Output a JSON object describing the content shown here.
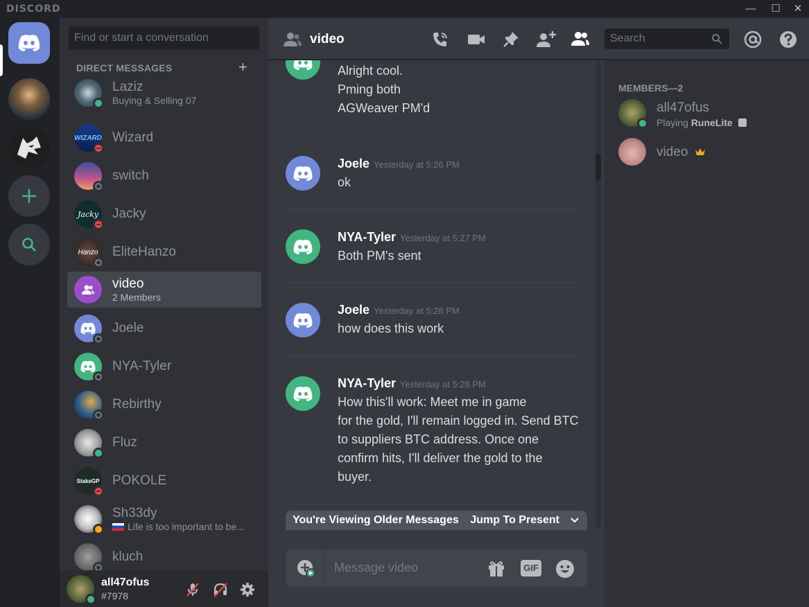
{
  "app": {
    "brand": "DISCORD"
  },
  "dm_panel": {
    "search_placeholder": "Find or start a conversation",
    "section_title": "DIRECT MESSAGES",
    "items": [
      {
        "name": "Laziz",
        "sub": "Buying & Selling 07",
        "status": "online"
      },
      {
        "name": "Wizard",
        "sub": "",
        "status": "dnd"
      },
      {
        "name": "switch",
        "sub": "",
        "status": "offline"
      },
      {
        "name": "Jacky",
        "sub": "",
        "status": "dnd"
      },
      {
        "name": "EliteHanzo",
        "sub": "",
        "status": "offline"
      },
      {
        "name": "video",
        "sub": "2 Members",
        "status": "group",
        "selected": true
      },
      {
        "name": "Joele",
        "sub": "",
        "status": "offline"
      },
      {
        "name": "NYA-Tyler",
        "sub": "",
        "status": "offline"
      },
      {
        "name": "Rebirthy",
        "sub": "",
        "status": "offline"
      },
      {
        "name": "Fluz",
        "sub": "",
        "status": "online"
      },
      {
        "name": "POKOLE",
        "sub": "",
        "status": "dnd"
      },
      {
        "name": "Sh33dy",
        "sub": "Life is too important to be...",
        "status": "idle"
      },
      {
        "name": "kluch",
        "sub": "",
        "status": "offline"
      }
    ]
  },
  "user_panel": {
    "username": "all47ofus",
    "tag": "#7978"
  },
  "header": {
    "channel": "video",
    "search_placeholder": "Search"
  },
  "messages": {
    "partial": {
      "lines": [
        "Alright cool.",
        "Pming both",
        "AGWeaver PM'd"
      ]
    },
    "items": [
      {
        "author": "Joele",
        "time": "Yesterday at 5:26 PM",
        "lines": [
          "ok"
        ],
        "avatar_color": "#7289da"
      },
      {
        "author": "NYA-Tyler",
        "time": "Yesterday at 5:27 PM",
        "lines": [
          "Both PM's sent"
        ],
        "avatar_color": "#43b581"
      },
      {
        "author": "Joele",
        "time": "Yesterday at 5:28 PM",
        "lines": [
          "how does this work"
        ],
        "avatar_color": "#7289da"
      },
      {
        "author": "NYA-Tyler",
        "time": "Yesterday at 5:28 PM",
        "lines": [
          "How this'll work: Meet me in game",
          "for the gold, I'll remain logged in. Send BTC",
          "to suppliers BTC address. Once one",
          "confirm hits, I'll deliver the gold to the",
          "buyer."
        ],
        "avatar_color": "#43b581"
      }
    ]
  },
  "older_bar": {
    "text": "You're Viewing Older Messages",
    "jump": "Jump To Present"
  },
  "composer": {
    "placeholder": "Message video",
    "gif": "GIF"
  },
  "member_list": {
    "header": "MEMBERS—2",
    "members": [
      {
        "name": "all47ofus",
        "activity_prefix": "Playing",
        "activity": "RuneLite",
        "status": "online"
      },
      {
        "name": "video",
        "owner": true
      }
    ]
  },
  "colors": {
    "blurple": "#7289da",
    "green": "#43b581",
    "red": "#f04747",
    "gray": "#747f8d"
  }
}
